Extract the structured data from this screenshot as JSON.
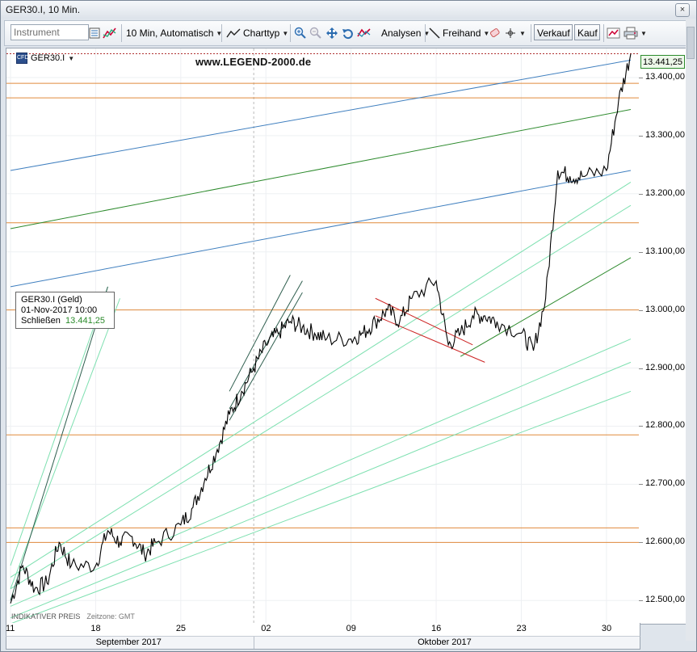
{
  "window": {
    "title": "GER30.I, 10 Min.",
    "close_glyph": "×"
  },
  "toolbar": {
    "instrument_placeholder": "Instrument",
    "interval_label": "10 Min,",
    "mode_label": "Automatisch",
    "charttype_label": "Charttyp",
    "analysen_label": "Analysen",
    "freihand_label": "Freihand",
    "sell_label": "Verkauf",
    "buy_label": "Kauf"
  },
  "chart": {
    "symbol": "GER30.I",
    "watermark": "www.LEGEND-2000.de",
    "last_price": "13.441,25",
    "footnote_left": "INDIKATIVER PREIS",
    "footnote_right": "Zeitzone: GMT",
    "info_box": {
      "title": "GER30.I (Geld)",
      "datetime": "01-Nov-2017 10:00",
      "close_label": "Schließen",
      "close_value": "13.441,25"
    }
  },
  "chart_data": {
    "type": "line",
    "title": "",
    "xlabel": "",
    "ylabel": "",
    "ylim": [
      12460,
      13450
    ],
    "y_ticks": [
      "13.400,00",
      "13.300,00",
      "13.200,00",
      "13.100,00",
      "13.000,00",
      "12.900,00",
      "12.800,00",
      "12.700,00",
      "12.600,00",
      "12.500,00"
    ],
    "y_tick_values": [
      13400,
      13300,
      13200,
      13100,
      13000,
      12900,
      12800,
      12700,
      12600,
      12500
    ],
    "x_ticks": [
      "11",
      "18",
      "25",
      "02",
      "09",
      "16",
      "23",
      "30"
    ],
    "x_tick_dates": [
      "2017-09-11",
      "2017-09-18",
      "2017-09-25",
      "2017-10-02",
      "2017-10-09",
      "2017-10-16",
      "2017-10-23",
      "2017-10-30"
    ],
    "x_range": [
      "2017-09-11",
      "2017-11-01"
    ],
    "months": [
      "September 2017",
      "Oktober 2017"
    ],
    "series": [
      {
        "x": [
          "2017-09-11",
          "2017-09-12",
          "2017-09-13",
          "2017-09-14",
          "2017-09-15",
          "2017-09-16",
          "2017-09-18",
          "2017-09-19",
          "2017-09-20",
          "2017-09-21",
          "2017-09-22",
          "2017-09-23",
          "2017-09-25",
          "2017-09-26",
          "2017-09-27",
          "2017-09-28",
          "2017-09-29",
          "2017-09-30",
          "2017-10-01",
          "2017-10-02",
          "2017-10-03",
          "2017-10-04",
          "2017-10-05",
          "2017-10-06",
          "2017-10-07",
          "2017-10-09",
          "2017-10-10",
          "2017-10-11",
          "2017-10-12",
          "2017-10-13",
          "2017-10-14",
          "2017-10-16",
          "2017-10-17",
          "2017-10-18",
          "2017-10-19",
          "2017-10-20",
          "2017-10-21",
          "2017-10-23",
          "2017-10-24",
          "2017-10-25",
          "2017-10-26",
          "2017-10-27",
          "2017-10-28",
          "2017-10-30",
          "2017-10-31",
          "2017-11-01"
        ],
        "values": [
          12495,
          12560,
          12520,
          12530,
          12600,
          12560,
          12560,
          12620,
          12600,
          12610,
          12580,
          12600,
          12630,
          12660,
          12710,
          12760,
          12820,
          12860,
          12900,
          12940,
          12960,
          12980,
          12970,
          12960,
          12950,
          12950,
          12960,
          12980,
          13000,
          12980,
          13020,
          13050,
          12940,
          12960,
          12990,
          12990,
          12980,
          12960,
          12930,
          13020,
          13240,
          13230,
          13230,
          13240,
          13360,
          13441
        ]
      }
    ],
    "horizontal_levels": [
      13390,
      13365,
      13150,
      13000,
      12785,
      12625,
      12600
    ],
    "trendlines": [
      {
        "color": "#3f7fbf",
        "from": [
          "2017-09-11",
          13240
        ],
        "to": [
          "2017-11-01",
          13430
        ]
      },
      {
        "color": "#2e8b2e",
        "from": [
          "2017-09-11",
          13140
        ],
        "to": [
          "2017-11-01",
          13345
        ]
      },
      {
        "color": "#3f7fbf",
        "from": [
          "2017-09-11",
          13040
        ],
        "to": [
          "2017-11-01",
          13240
        ]
      },
      {
        "color": "#2e8b2e",
        "from": [
          "2017-10-18",
          12920
        ],
        "to": [
          "2017-11-01",
          13090
        ]
      },
      {
        "color": "#cc2222",
        "from": [
          "2017-10-11",
          13020
        ],
        "to": [
          "2017-10-19",
          12940
        ]
      },
      {
        "color": "#cc2222",
        "from": [
          "2017-10-11",
          12990
        ],
        "to": [
          "2017-10-20",
          12910
        ]
      }
    ]
  },
  "colors": {
    "price_line": "#000000",
    "h_level": "#e08a3c",
    "channel_light": "#7ee0b0",
    "channel_dark": "#2e5e4e",
    "trend_blue": "#3f7fbf",
    "trend_green": "#2e8b2e",
    "trend_red": "#cc2222"
  }
}
